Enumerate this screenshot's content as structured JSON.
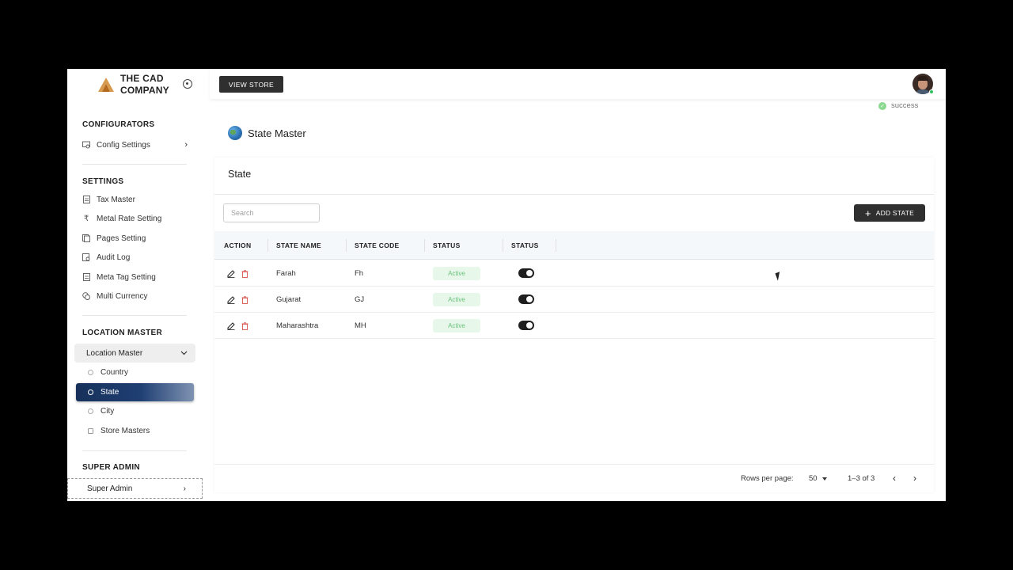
{
  "brand": {
    "line1": "THE CAD",
    "line2": "COMPANY"
  },
  "sidebar": {
    "configurators": {
      "title": "CONFIGURATORS",
      "items": [
        {
          "label": "Config Settings",
          "icon": "settings-screen-icon"
        }
      ]
    },
    "settings": {
      "title": "SETTINGS",
      "items": [
        {
          "label": "Tax Master",
          "icon": "document-icon"
        },
        {
          "label": "Metal Rate Setting",
          "icon": "rupee-icon"
        },
        {
          "label": "Pages Setting",
          "icon": "pages-icon"
        },
        {
          "label": "Audit Log",
          "icon": "audit-icon"
        },
        {
          "label": "Meta Tag Setting",
          "icon": "document-icon"
        },
        {
          "label": "Multi Currency",
          "icon": "currency-icon"
        }
      ]
    },
    "location": {
      "title": "LOCATION MASTER",
      "group_label": "Location Master",
      "items": [
        {
          "label": "Country"
        },
        {
          "label": "State"
        },
        {
          "label": "City"
        },
        {
          "label": "Store Masters"
        }
      ]
    },
    "super_admin": {
      "title": "SUPER ADMIN",
      "item_label": "Super Admin"
    }
  },
  "topbar": {
    "view_store": "VIEW STORE"
  },
  "toast": {
    "text": "success"
  },
  "page": {
    "title": "State Master"
  },
  "card": {
    "title": "State",
    "search_placeholder": "Search",
    "add_label": "ADD STATE",
    "columns": [
      "ACTION",
      "STATE NAME",
      "STATE CODE",
      "STATUS",
      "STATUS"
    ],
    "rows": [
      {
        "name": "Farah",
        "code": "Fh",
        "status": "Active"
      },
      {
        "name": "Gujarat",
        "code": "GJ",
        "status": "Active"
      },
      {
        "name": "Maharashtra",
        "code": "MH",
        "status": "Active"
      }
    ],
    "footer": {
      "rows_per_page_label": "Rows per page:",
      "rows_per_page": "50",
      "range": "1–3 of 3"
    }
  },
  "colors": {
    "active_nav": "#1f3f73",
    "badge_bg": "#e7f8ea",
    "badge_text": "#6cc07d",
    "dark_button": "#2f2f2f"
  }
}
